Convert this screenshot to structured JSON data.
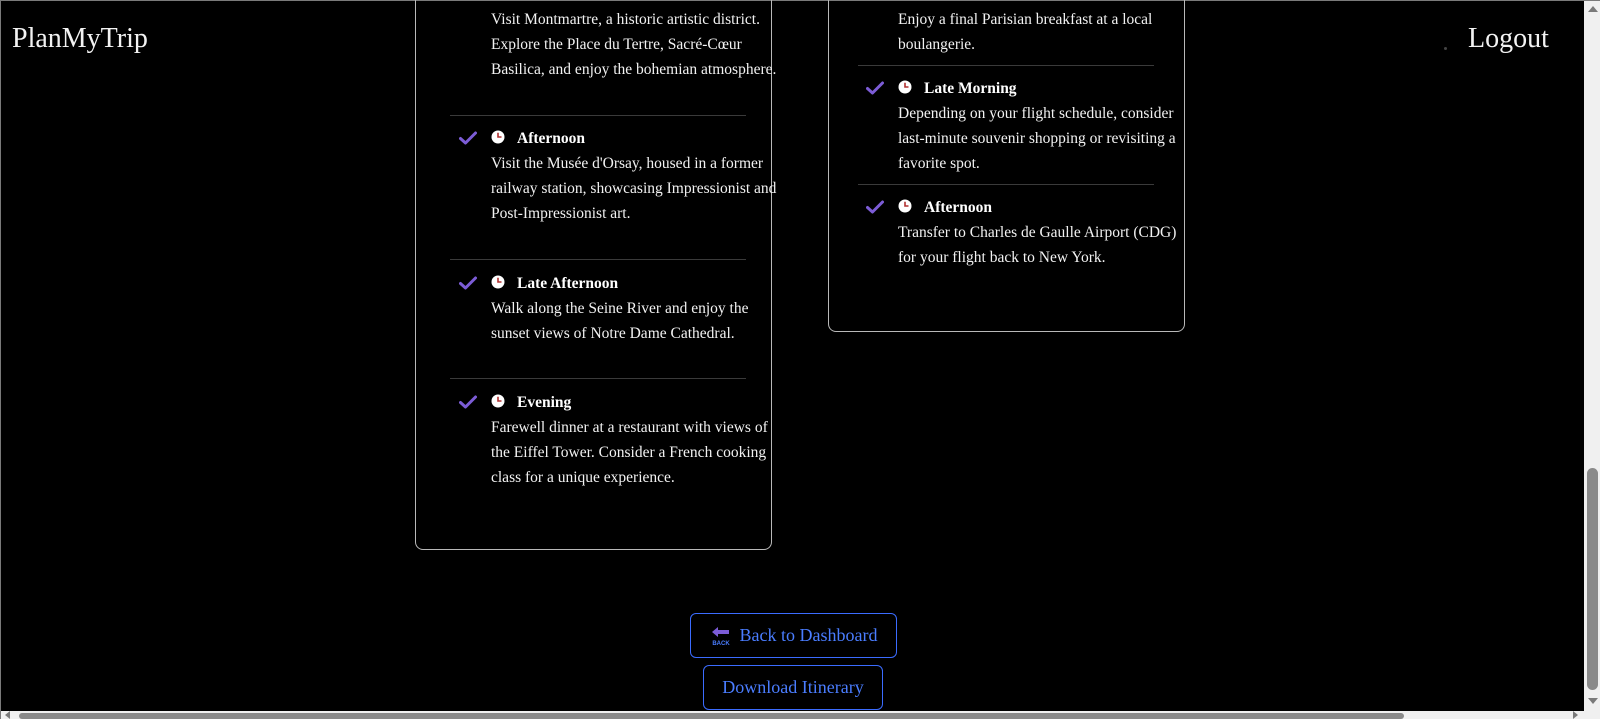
{
  "header": {
    "brand": "PlanMyTrip",
    "logout_label": "Logout"
  },
  "left_card": {
    "first_desc": "Visit Montmartre, a historic artistic district. Explore the Place du Tertre, Sacré-Cœur Basilica, and enjoy the bohemian atmosphere.",
    "activities": [
      {
        "time": "Afternoon",
        "desc": "Visit the Musée d'Orsay, housed in a former railway station, showcasing Impressionist and Post-Impressionist art."
      },
      {
        "time": "Late Afternoon",
        "desc": "Walk along the Seine River and enjoy the sunset views of Notre Dame Cathedral."
      },
      {
        "time": "Evening",
        "desc": "Farewell dinner at a restaurant with views of the Eiffel Tower. Consider a French cooking class for a unique experience."
      }
    ]
  },
  "right_card": {
    "first_desc": "Enjoy a final Parisian breakfast at a local boulangerie.",
    "activities": [
      {
        "time": "Late Morning",
        "desc": "Depending on your flight schedule, consider last-minute souvenir shopping or revisiting a favorite spot."
      },
      {
        "time": "Afternoon",
        "desc": "Transfer to Charles de Gaulle Airport (CDG) for your flight back to New York."
      }
    ]
  },
  "buttons": {
    "back_label": "Back to Dashboard",
    "back_icon_text": "BACK",
    "download_label": "Download Itinerary"
  },
  "icons": {
    "check": "check-icon",
    "clock": "clock-icon",
    "back": "back-arrow-icon"
  },
  "colors": {
    "accent_check": "#7c5cd6",
    "button_blue": "#4a7dff",
    "background": "#000000"
  }
}
